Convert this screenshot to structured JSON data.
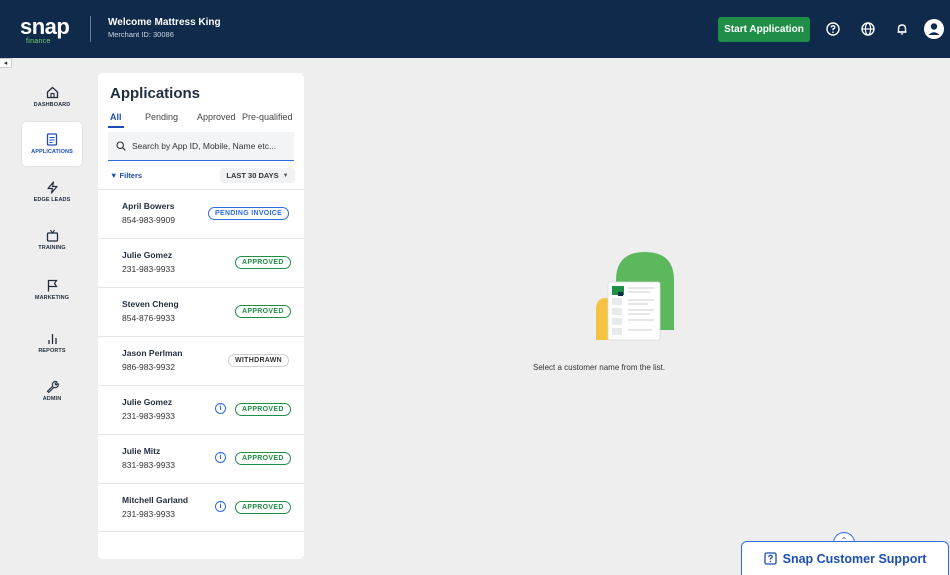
{
  "header": {
    "logo": "snap",
    "logo_sub": "finance",
    "welcome": "Welcome Mattress King",
    "merchant": "Merchant ID: 30086",
    "start_button": "Start Application"
  },
  "sidebar": {
    "items": [
      {
        "label": "DASHBOARD",
        "icon": "home-icon",
        "active": false
      },
      {
        "label": "APPLICATIONS",
        "icon": "document-icon",
        "active": true
      },
      {
        "label": "EDGE LEADS",
        "icon": "lightning-icon",
        "active": false
      },
      {
        "label": "TRAINING",
        "icon": "tv-icon",
        "active": false
      },
      {
        "label": "MARKETING",
        "icon": "flag-icon",
        "active": false
      },
      {
        "label": "REPORTS",
        "icon": "bar-chart-icon",
        "active": false
      },
      {
        "label": "ADMIN",
        "icon": "wrench-icon",
        "active": false
      }
    ]
  },
  "panel": {
    "title": "Applications",
    "tabs": [
      "All",
      "Pending",
      "Approved",
      "Pre-qualified"
    ],
    "search_placeholder": "Search by App ID, Mobile, Name etc...",
    "filters_label": "Filters",
    "range_label": "LAST 30 DAYS"
  },
  "applications": [
    {
      "name": "April Bowers",
      "phone": "854-983-9909",
      "status": "PENDING INVOICE",
      "info": false
    },
    {
      "name": "Julie Gomez",
      "phone": "231-983-9933",
      "status": "APPROVED",
      "info": false
    },
    {
      "name": "Steven Cheng",
      "phone": "854-876-9933",
      "status": "APPROVED",
      "info": false
    },
    {
      "name": "Jason Perlman",
      "phone": "986-983-9932",
      "status": "WITHDRAWN",
      "info": false
    },
    {
      "name": "Julie Gomez",
      "phone": "231-983-9933",
      "status": "APPROVED",
      "info": true
    },
    {
      "name": "Julie Mitz",
      "phone": "831-983-9933",
      "status": "APPROVED",
      "info": true
    },
    {
      "name": "Mitchell Garland",
      "phone": "231-983-9933",
      "status": "APPROVED",
      "info": true
    }
  ],
  "empty_state": {
    "text": "Select a customer name from the list."
  },
  "support": {
    "label": "Snap Customer Support"
  },
  "colors": {
    "header_bg": "#0f2a4a",
    "primary_green": "#1f8f48",
    "primary_blue": "#1b4fb1"
  }
}
